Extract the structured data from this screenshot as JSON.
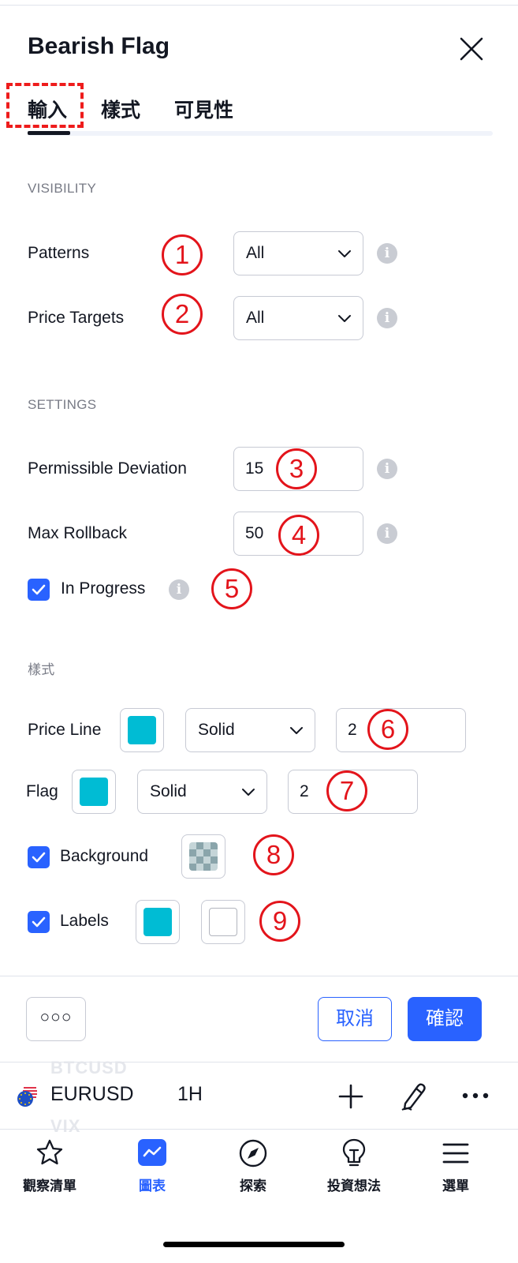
{
  "dialog": {
    "title": "Bearish Flag",
    "tabs": [
      {
        "label": "輸入",
        "active": true
      },
      {
        "label": "樣式",
        "active": false
      },
      {
        "label": "可見性",
        "active": false
      }
    ]
  },
  "visibility": {
    "section_label": "VISIBILITY",
    "patterns": {
      "label": "Patterns",
      "value": "All"
    },
    "price_targets": {
      "label": "Price Targets",
      "value": "All"
    }
  },
  "settings": {
    "section_label": "SETTINGS",
    "permissible_deviation": {
      "label": "Permissible Deviation",
      "value": "15"
    },
    "max_rollback": {
      "label": "Max Rollback",
      "value": "50"
    },
    "in_progress": {
      "label": "In Progress",
      "checked": true
    }
  },
  "style": {
    "section_label": "樣式",
    "price_line": {
      "label": "Price Line",
      "color": "#00bcd4",
      "line_style": "Solid",
      "width": "2"
    },
    "flag": {
      "label": "Flag",
      "color": "#00bcd4",
      "line_style": "Solid",
      "width": "2"
    },
    "background": {
      "label": "Background",
      "checked": true
    },
    "labels": {
      "label": "Labels",
      "checked": true,
      "color": "#00bcd4",
      "text_color": "#ffffff"
    }
  },
  "annotations": [
    "1",
    "2",
    "3",
    "4",
    "5",
    "6",
    "7",
    "8",
    "9"
  ],
  "footer": {
    "more_label": "○○○",
    "cancel_label": "取消",
    "ok_label": "確認"
  },
  "chart_bar": {
    "ghost_top": "BTCUSD",
    "symbol": "EURUSD",
    "interval": "1H",
    "ghost_bottom": "VIX"
  },
  "bottom_nav": [
    {
      "label": "觀察清單",
      "icon": "star-icon",
      "active": false
    },
    {
      "label": "圖表",
      "icon": "chart-icon",
      "active": true
    },
    {
      "label": "探索",
      "icon": "compass-icon",
      "active": false
    },
    {
      "label": "投資想法",
      "icon": "lightbulb-icon",
      "active": false
    },
    {
      "label": "選單",
      "icon": "menu-icon",
      "active": false
    }
  ],
  "colors": {
    "accent": "#2962ff",
    "annotation_red": "#e3141b",
    "swatch_cyan": "#00bcd4"
  }
}
